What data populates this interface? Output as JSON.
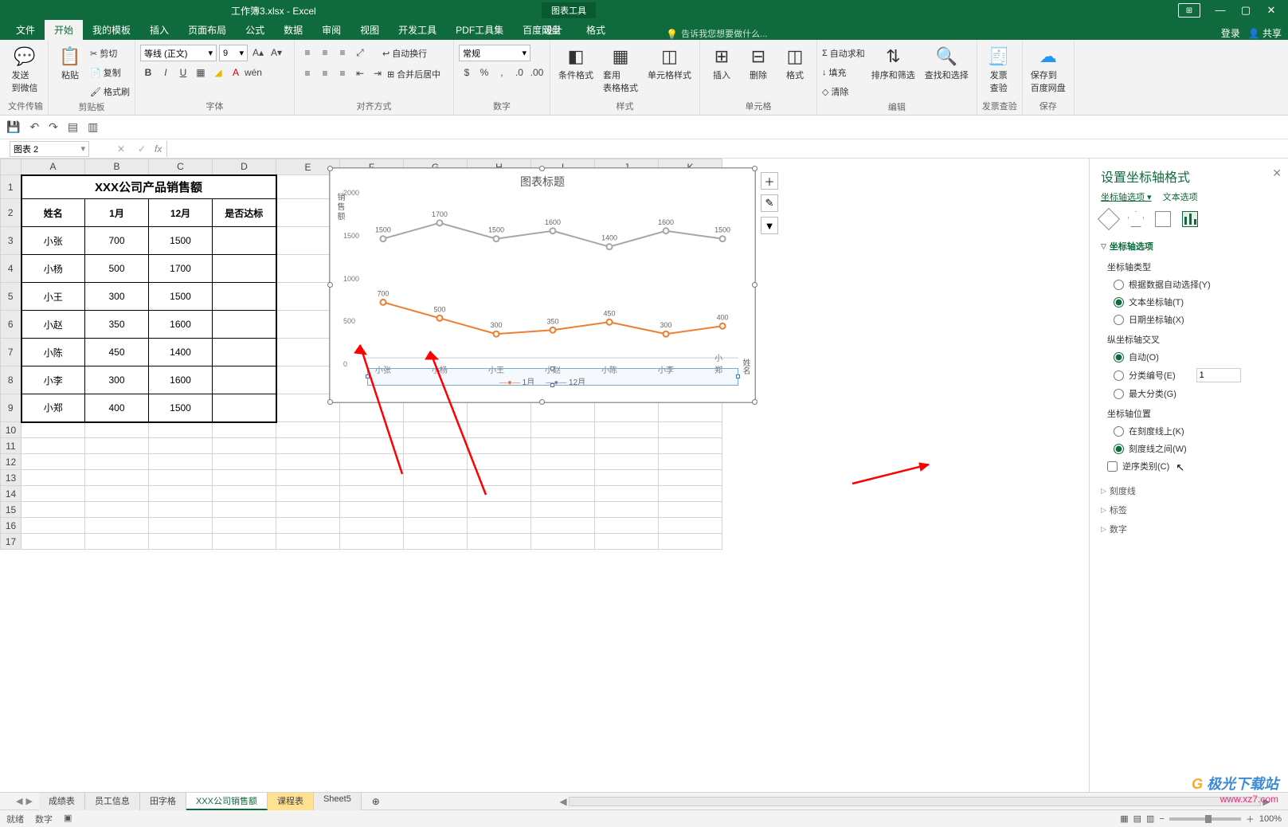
{
  "title_doc": "工作簿3.xlsx - Excel",
  "context_tool": "图表工具",
  "window_buttons": {
    "ribbon_tip": "⊞",
    "min": "—",
    "max": "▢",
    "close": "✕"
  },
  "account": {
    "login": "登录",
    "share": "共享"
  },
  "ribbon_tabs": [
    "文件",
    "开始",
    "我的模板",
    "插入",
    "页面布局",
    "公式",
    "数据",
    "审阅",
    "视图",
    "开发工具",
    "PDF工具集",
    "百度网盘"
  ],
  "context_tabs": [
    "设计",
    "格式"
  ],
  "tell_me": "告诉我您想要做什么...",
  "ribbon": {
    "g1": {
      "label": "文件传输",
      "btn": "发送\n到微信"
    },
    "g2": {
      "label": "剪贴板",
      "paste": "粘贴",
      "cut": "剪切",
      "copy": "复制",
      "brush": "格式刷"
    },
    "g3": {
      "label": "字体",
      "font": "等线 (正文)",
      "size": "9"
    },
    "g4": {
      "label": "对齐方式",
      "wrap": "自动换行",
      "merge": "合并后居中"
    },
    "g5": {
      "label": "数字",
      "fmt": "常规"
    },
    "g6": {
      "label": "样式",
      "b1": "条件格式",
      "b2": "套用\n表格格式",
      "b3": "单元格样式"
    },
    "g7": {
      "label": "单元格",
      "b1": "插入",
      "b2": "删除",
      "b3": "格式"
    },
    "g8": {
      "label": "编辑",
      "sum": "自动求和",
      "fill": "填充",
      "clear": "清除",
      "sort": "排序和筛选",
      "find": "查找和选择"
    },
    "g9": {
      "label": "发票查验",
      "btn": "发票\n查验"
    },
    "g10": {
      "label": "保存",
      "btn": "保存到\n百度网盘"
    }
  },
  "namebox": "图表 2",
  "table": {
    "title": "XXX公司产品销售额",
    "headers": [
      "姓名",
      "1月",
      "12月",
      "是否达标"
    ],
    "rows": [
      [
        "小张",
        "700",
        "1500",
        ""
      ],
      [
        "小杨",
        "500",
        "1700",
        ""
      ],
      [
        "小王",
        "300",
        "1500",
        ""
      ],
      [
        "小赵",
        "350",
        "1600",
        ""
      ],
      [
        "小陈",
        "450",
        "1400",
        ""
      ],
      [
        "小李",
        "300",
        "1600",
        ""
      ],
      [
        "小郑",
        "400",
        "1500",
        ""
      ]
    ]
  },
  "columns": [
    "A",
    "B",
    "C",
    "D",
    "E",
    "F",
    "G",
    "H",
    "I",
    "J",
    "K"
  ],
  "chart_data": {
    "type": "line",
    "title": "图表标题",
    "categories": [
      "小张",
      "小杨",
      "小王",
      "小赵",
      "小陈",
      "小李",
      "小郑"
    ],
    "series": [
      {
        "name": "1月",
        "values": [
          700,
          500,
          300,
          350,
          450,
          300,
          400
        ],
        "color": "#ed7d31"
      },
      {
        "name": "12月",
        "values": [
          1500,
          1700,
          1500,
          1600,
          1400,
          1600,
          1500
        ],
        "color": "#a6a6a6"
      }
    ],
    "xlabel": "姓名",
    "ylabel": "销售额",
    "ylim": [
      0,
      2000
    ],
    "yticks": [
      0,
      500,
      1000,
      1500,
      2000
    ]
  },
  "chart_side_buttons": [
    "＋",
    "✎",
    "▼"
  ],
  "sidepane": {
    "title": "设置坐标轴格式",
    "subtabs": [
      "坐标轴选项",
      "文本选项"
    ],
    "section": "坐标轴选项",
    "axis_type_label": "坐标轴类型",
    "axis_type": [
      "根据数据自动选择(Y)",
      "文本坐标轴(T)",
      "日期坐标轴(X)"
    ],
    "cross_label": "纵坐标轴交叉",
    "cross": [
      "自动(O)",
      "分类编号(E)",
      "最大分类(G)"
    ],
    "cross_num": "1",
    "pos_label": "坐标轴位置",
    "pos": [
      "在刻度线上(K)",
      "刻度线之间(W)"
    ],
    "reverse": "逆序类别(C)",
    "expand": [
      "刻度线",
      "标签",
      "数字"
    ]
  },
  "sheet_tabs": [
    "成绩表",
    "员工信息",
    "田字格",
    "XXX公司销售额",
    "课程表",
    "Sheet5"
  ],
  "active_sheet": 3,
  "highlight_sheet": 4,
  "status": {
    "left_a": "就绪",
    "left_b": "数字",
    "zoom": "100%"
  },
  "watermark": {
    "brand": "极光下载站",
    "url": "www.xz7.com"
  }
}
